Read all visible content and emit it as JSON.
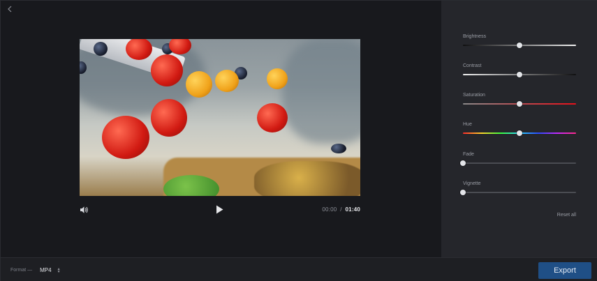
{
  "player": {
    "current_time": "00:00",
    "separator": "/",
    "duration": "01:40"
  },
  "adjustments": [
    {
      "label": "Brightness",
      "value": 0.5,
      "track": "linear-gradient(90deg,#0f0f10,#f3f3f3)"
    },
    {
      "label": "Contrast",
      "value": 0.5,
      "track": "linear-gradient(90deg,#f3f3f3,#0f0f10)"
    },
    {
      "label": "Saturation",
      "value": 0.5,
      "track": "linear-gradient(90deg,#8a8a8a,#e8101a)"
    },
    {
      "label": "Hue",
      "value": 0.5,
      "track": "linear-gradient(90deg,#ff2a2a,#ffd52a,#3cff3c,#2ad5ff,#2a4bff,#c52aff,#ff2a8a)"
    },
    {
      "label": "Fade",
      "value": 0.0,
      "track": "#4a4c52"
    },
    {
      "label": "Vignette",
      "value": 0.0,
      "track": "#4a4c52"
    }
  ],
  "panel": {
    "reset_label": "Reset all"
  },
  "bottom": {
    "format_label": "Format —",
    "format_value": "MP4",
    "export_label": "Export"
  },
  "colors": {
    "accent": "#1f4f86",
    "panel_bg": "#25262b",
    "app_bg": "#17181c"
  }
}
